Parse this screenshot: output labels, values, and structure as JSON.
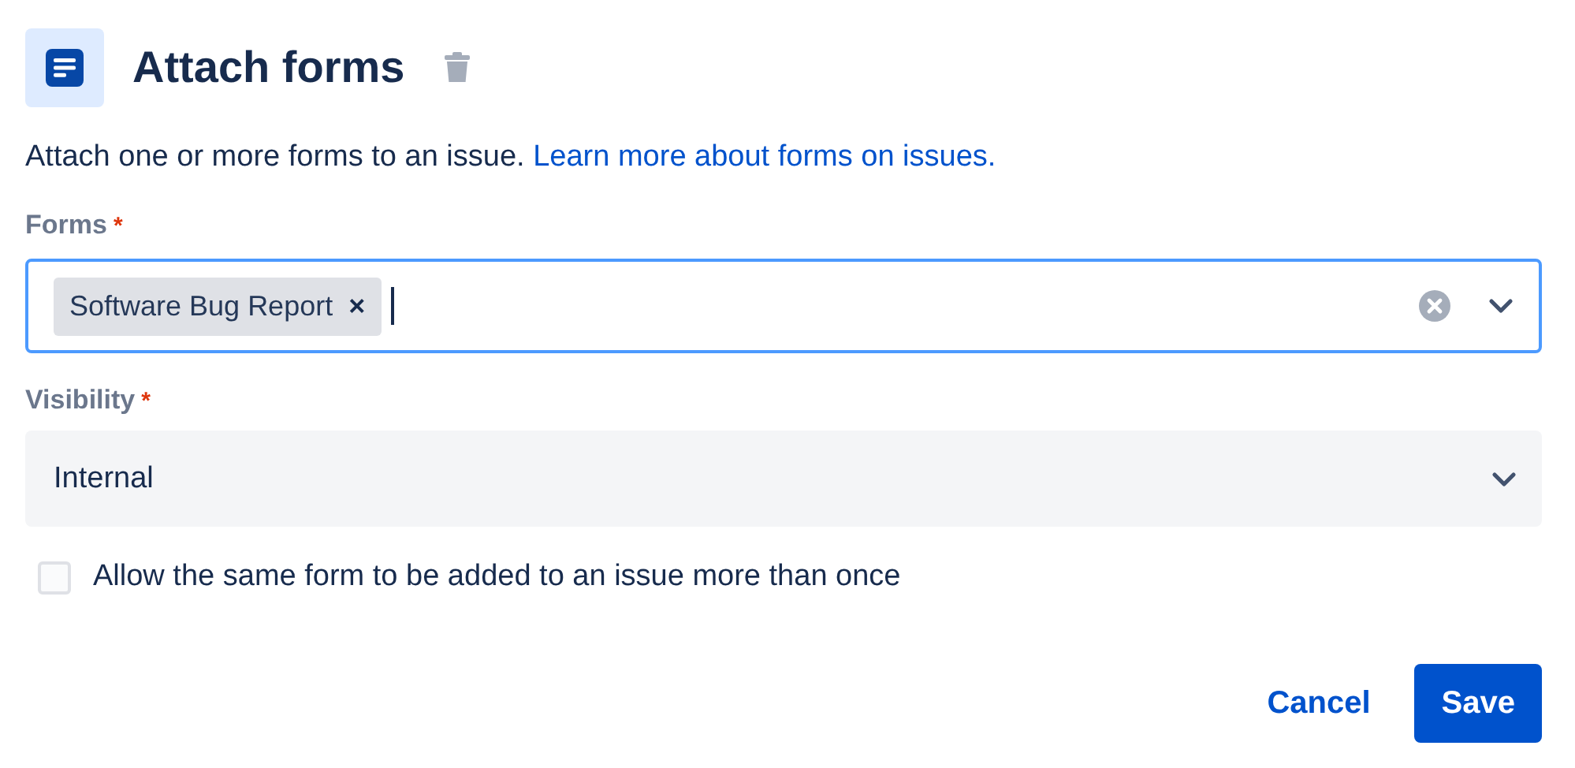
{
  "header": {
    "title": "Attach forms"
  },
  "description": {
    "text": "Attach one or more forms to an issue.",
    "link": "Learn more about forms on issues."
  },
  "forms_field": {
    "label": "Forms",
    "required_mark": "*",
    "focused": true,
    "tags": [
      {
        "label": "Software Bug Report",
        "remove": "×"
      }
    ]
  },
  "visibility_field": {
    "label": "Visibility",
    "required_mark": "*",
    "value": "Internal"
  },
  "option": {
    "label": "Allow the same form to be added to an issue more than once",
    "checked": false
  },
  "buttons": [
    {
      "label": "Cancel",
      "kind": "subtle"
    },
    {
      "label": "Save",
      "kind": "primary"
    }
  ]
}
